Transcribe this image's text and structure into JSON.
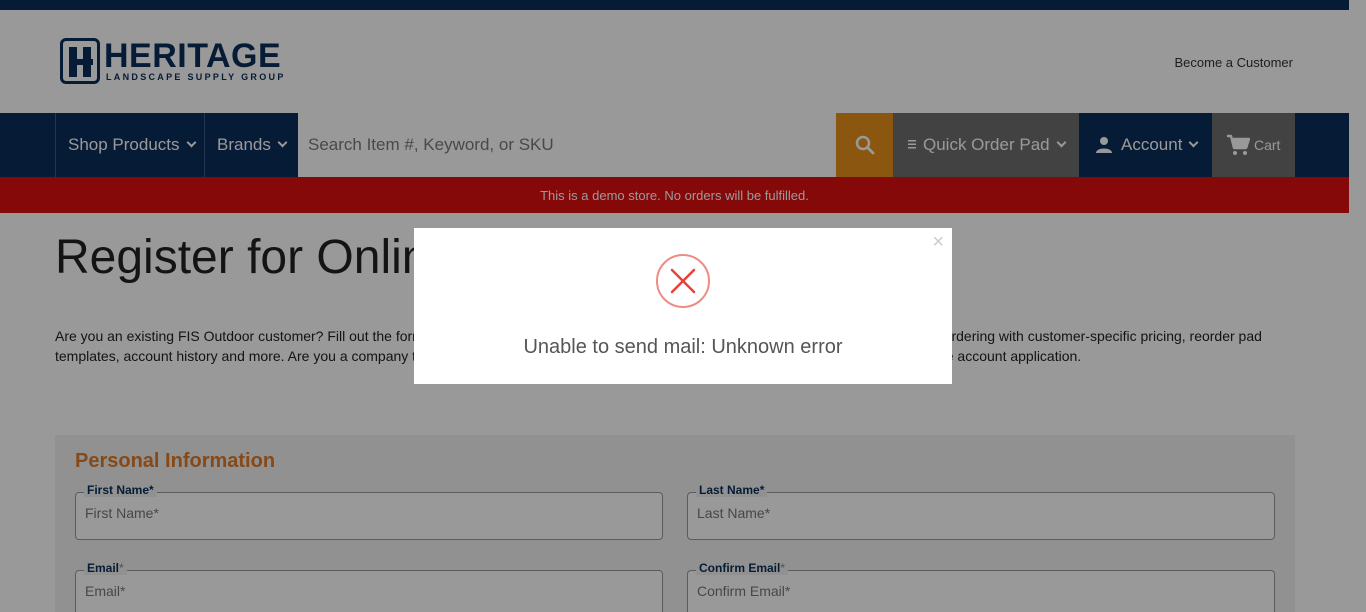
{
  "header": {
    "logo_name": "HERITAGE",
    "logo_tagline": "LANDSCAPE SUPPLY GROUP",
    "become_customer": "Become a Customer"
  },
  "nav": {
    "shop_products": "Shop Products",
    "brands": "Brands",
    "search_placeholder": "Search Item #, Keyword, or SKU",
    "quick_order_pad": "Quick Order Pad",
    "account": "Account",
    "cart": "Cart"
  },
  "demo_banner": "This is a demo store. No orders will be fulfilled.",
  "page": {
    "title": "Register for Online",
    "intro": "Are you an existing FIS Outdoor customer? Fill out the form below to register for an online account and you will receive instant access to online ordering with customer-specific pricing, reorder pad templates, account history and more. Are you a company that is not yet an FIS customer? Visit our Become A Customer Page to submit an online account application."
  },
  "form": {
    "section_title": "Personal Information",
    "first_name_label": "First Name*",
    "first_name_placeholder": "First Name*",
    "last_name_label": "Last Name*",
    "last_name_placeholder": "Last Name*",
    "email_label": "Email",
    "email_placeholder": "Email*",
    "confirm_email_label": "Confirm Email",
    "confirm_email_placeholder": "Confirm Email*",
    "required_mark": "*"
  },
  "modal": {
    "close": "×",
    "message": "Unable to send mail: Unknown error"
  },
  "colors": {
    "navy": "#0b2e59",
    "orange": "#e8901b",
    "red_banner": "#e01010",
    "error_icon": "#e8413a"
  }
}
